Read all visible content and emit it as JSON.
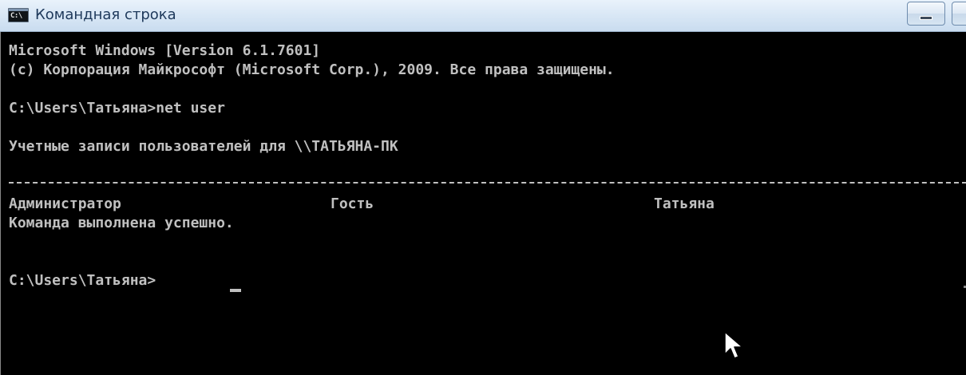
{
  "window": {
    "title": "Командная строка",
    "icon_glyph": "C:\\",
    "icon": "cmd-window-icon"
  },
  "console": {
    "lines": [
      "Microsoft Windows [Version 6.1.7601]",
      "(c) Корпорация Майкрософт (Microsoft Corp.), 2009. Все права защищены.",
      "C:\\Users\\Татьяна>net user",
      "Учетные записи пользователей для \\\\ТАТЬЯНА-ПК"
    ],
    "accounts": [
      "Администратор",
      "Гость",
      "Татьяна"
    ],
    "status": "Команда выполнена успешно.",
    "prompt": "C:\\Users\\Татьяна>"
  },
  "colors": {
    "console_background": "#000000",
    "console_text": "#c0c0c0",
    "title_text": "#1e395b"
  }
}
